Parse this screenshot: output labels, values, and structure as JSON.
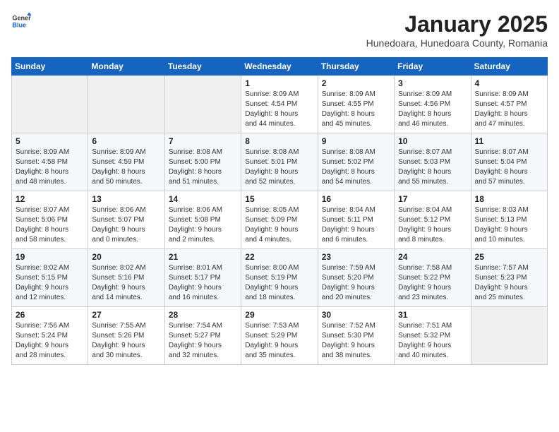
{
  "header": {
    "logo_general": "General",
    "logo_blue": "Blue",
    "title": "January 2025",
    "subtitle": "Hunedoara, Hunedoara County, Romania"
  },
  "weekdays": [
    "Sunday",
    "Monday",
    "Tuesday",
    "Wednesday",
    "Thursday",
    "Friday",
    "Saturday"
  ],
  "weeks": [
    [
      {
        "day": "",
        "info": ""
      },
      {
        "day": "",
        "info": ""
      },
      {
        "day": "",
        "info": ""
      },
      {
        "day": "1",
        "info": "Sunrise: 8:09 AM\nSunset: 4:54 PM\nDaylight: 8 hours\nand 44 minutes."
      },
      {
        "day": "2",
        "info": "Sunrise: 8:09 AM\nSunset: 4:55 PM\nDaylight: 8 hours\nand 45 minutes."
      },
      {
        "day": "3",
        "info": "Sunrise: 8:09 AM\nSunset: 4:56 PM\nDaylight: 8 hours\nand 46 minutes."
      },
      {
        "day": "4",
        "info": "Sunrise: 8:09 AM\nSunset: 4:57 PM\nDaylight: 8 hours\nand 47 minutes."
      }
    ],
    [
      {
        "day": "5",
        "info": "Sunrise: 8:09 AM\nSunset: 4:58 PM\nDaylight: 8 hours\nand 48 minutes."
      },
      {
        "day": "6",
        "info": "Sunrise: 8:09 AM\nSunset: 4:59 PM\nDaylight: 8 hours\nand 50 minutes."
      },
      {
        "day": "7",
        "info": "Sunrise: 8:08 AM\nSunset: 5:00 PM\nDaylight: 8 hours\nand 51 minutes."
      },
      {
        "day": "8",
        "info": "Sunrise: 8:08 AM\nSunset: 5:01 PM\nDaylight: 8 hours\nand 52 minutes."
      },
      {
        "day": "9",
        "info": "Sunrise: 8:08 AM\nSunset: 5:02 PM\nDaylight: 8 hours\nand 54 minutes."
      },
      {
        "day": "10",
        "info": "Sunrise: 8:07 AM\nSunset: 5:03 PM\nDaylight: 8 hours\nand 55 minutes."
      },
      {
        "day": "11",
        "info": "Sunrise: 8:07 AM\nSunset: 5:04 PM\nDaylight: 8 hours\nand 57 minutes."
      }
    ],
    [
      {
        "day": "12",
        "info": "Sunrise: 8:07 AM\nSunset: 5:06 PM\nDaylight: 8 hours\nand 58 minutes."
      },
      {
        "day": "13",
        "info": "Sunrise: 8:06 AM\nSunset: 5:07 PM\nDaylight: 9 hours\nand 0 minutes."
      },
      {
        "day": "14",
        "info": "Sunrise: 8:06 AM\nSunset: 5:08 PM\nDaylight: 9 hours\nand 2 minutes."
      },
      {
        "day": "15",
        "info": "Sunrise: 8:05 AM\nSunset: 5:09 PM\nDaylight: 9 hours\nand 4 minutes."
      },
      {
        "day": "16",
        "info": "Sunrise: 8:04 AM\nSunset: 5:11 PM\nDaylight: 9 hours\nand 6 minutes."
      },
      {
        "day": "17",
        "info": "Sunrise: 8:04 AM\nSunset: 5:12 PM\nDaylight: 9 hours\nand 8 minutes."
      },
      {
        "day": "18",
        "info": "Sunrise: 8:03 AM\nSunset: 5:13 PM\nDaylight: 9 hours\nand 10 minutes."
      }
    ],
    [
      {
        "day": "19",
        "info": "Sunrise: 8:02 AM\nSunset: 5:15 PM\nDaylight: 9 hours\nand 12 minutes."
      },
      {
        "day": "20",
        "info": "Sunrise: 8:02 AM\nSunset: 5:16 PM\nDaylight: 9 hours\nand 14 minutes."
      },
      {
        "day": "21",
        "info": "Sunrise: 8:01 AM\nSunset: 5:17 PM\nDaylight: 9 hours\nand 16 minutes."
      },
      {
        "day": "22",
        "info": "Sunrise: 8:00 AM\nSunset: 5:19 PM\nDaylight: 9 hours\nand 18 minutes."
      },
      {
        "day": "23",
        "info": "Sunrise: 7:59 AM\nSunset: 5:20 PM\nDaylight: 9 hours\nand 20 minutes."
      },
      {
        "day": "24",
        "info": "Sunrise: 7:58 AM\nSunset: 5:22 PM\nDaylight: 9 hours\nand 23 minutes."
      },
      {
        "day": "25",
        "info": "Sunrise: 7:57 AM\nSunset: 5:23 PM\nDaylight: 9 hours\nand 25 minutes."
      }
    ],
    [
      {
        "day": "26",
        "info": "Sunrise: 7:56 AM\nSunset: 5:24 PM\nDaylight: 9 hours\nand 28 minutes."
      },
      {
        "day": "27",
        "info": "Sunrise: 7:55 AM\nSunset: 5:26 PM\nDaylight: 9 hours\nand 30 minutes."
      },
      {
        "day": "28",
        "info": "Sunrise: 7:54 AM\nSunset: 5:27 PM\nDaylight: 9 hours\nand 32 minutes."
      },
      {
        "day": "29",
        "info": "Sunrise: 7:53 AM\nSunset: 5:29 PM\nDaylight: 9 hours\nand 35 minutes."
      },
      {
        "day": "30",
        "info": "Sunrise: 7:52 AM\nSunset: 5:30 PM\nDaylight: 9 hours\nand 38 minutes."
      },
      {
        "day": "31",
        "info": "Sunrise: 7:51 AM\nSunset: 5:32 PM\nDaylight: 9 hours\nand 40 minutes."
      },
      {
        "day": "",
        "info": ""
      }
    ]
  ]
}
